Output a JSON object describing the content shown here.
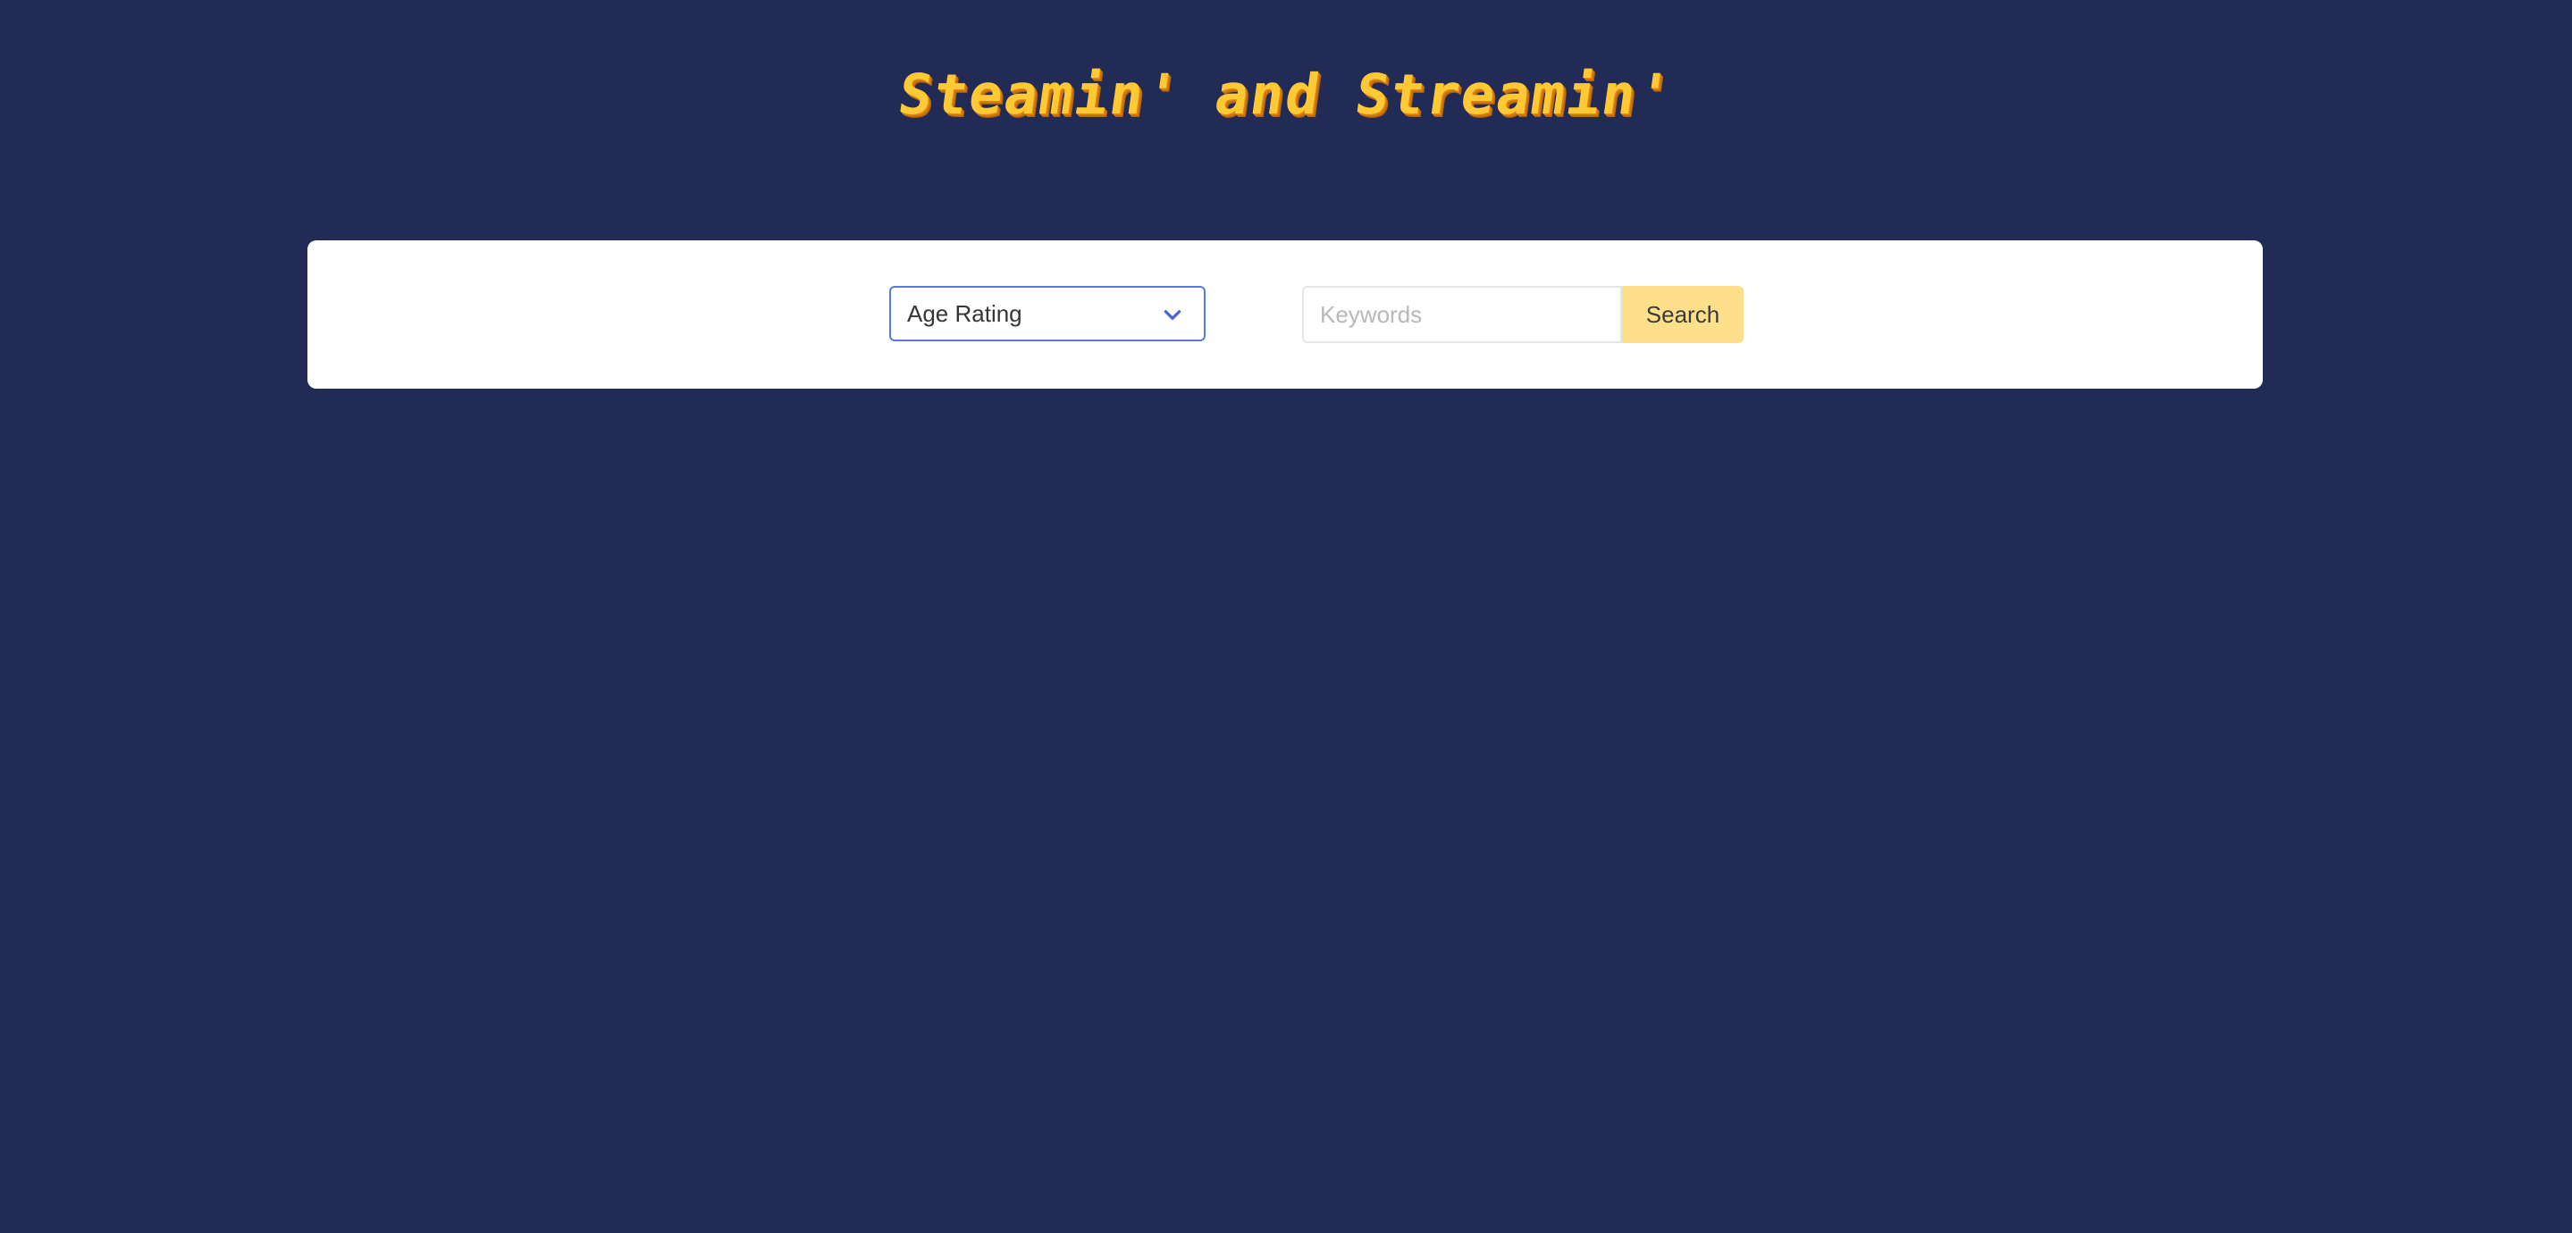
{
  "app": {
    "title": "Steamin' and Streamin'"
  },
  "search_panel": {
    "age_rating": {
      "selected_label": "Age Rating",
      "icon": "chevron-down-icon"
    },
    "keywords": {
      "value": "",
      "placeholder": "Keywords"
    },
    "search_button_label": "Search"
  },
  "colors": {
    "page_background": "#222a56",
    "panel_background": "#ffffff",
    "logo_primary": "#ffc936",
    "select_border": "#5b78e0",
    "search_button": "#ffe08a"
  }
}
